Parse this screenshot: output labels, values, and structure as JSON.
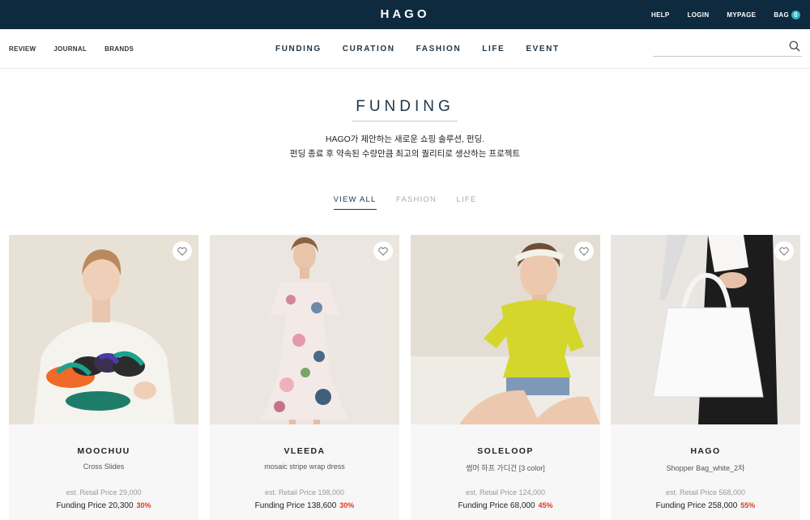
{
  "header": {
    "logo": "HAGO",
    "util_links": [
      "HELP",
      "LOGIN",
      "MYPAGE",
      "BAG"
    ],
    "bag_count": "0"
  },
  "left_nav": [
    "REVIEW",
    "JOURNAL",
    "BRANDS"
  ],
  "main_nav": [
    "FUNDING",
    "CURATION",
    "FASHION",
    "LIFE",
    "EVENT"
  ],
  "search": {
    "placeholder": "",
    "icon": "search-icon"
  },
  "hero": {
    "title": "FUNDING",
    "subtitle_line1": "HAGO가 제안하는 새로운 쇼핑 솔루션, 펀딩.",
    "subtitle_line2": "펀딩 종료 후 약속된 수량만큼 최고의 퀄리티로 생산하는 프로젝트"
  },
  "filters": {
    "tabs": [
      "VIEW ALL",
      "FASHION",
      "LIFE"
    ],
    "active": "VIEW ALL"
  },
  "products": [
    {
      "brand": "MOOCHUU",
      "name": "Cross Slides",
      "retail": "est. Retail Price 29,000",
      "funding": "Funding Price 20,300",
      "discount": "30%"
    },
    {
      "brand": "VLEEDA",
      "name": "mosaic stripe wrap dress",
      "retail": "est. Retail Price 198,000",
      "funding": "Funding Price 138,600",
      "discount": "30%"
    },
    {
      "brand": "SOLELOOP",
      "name": "썸머 하프 가디건 [3 color]",
      "retail": "est. Retail Price 124,000",
      "funding": "Funding Price 68,000",
      "discount": "45%"
    },
    {
      "brand": "HAGO",
      "name": "Shopper Bag_white_2차",
      "retail": "est. Retail Price 568,000",
      "funding": "Funding Price 258,000",
      "discount": "55%"
    }
  ],
  "colors": {
    "header_bg": "#0e2a3e",
    "accent": "#26b9c3",
    "discount": "#e03a1e"
  }
}
